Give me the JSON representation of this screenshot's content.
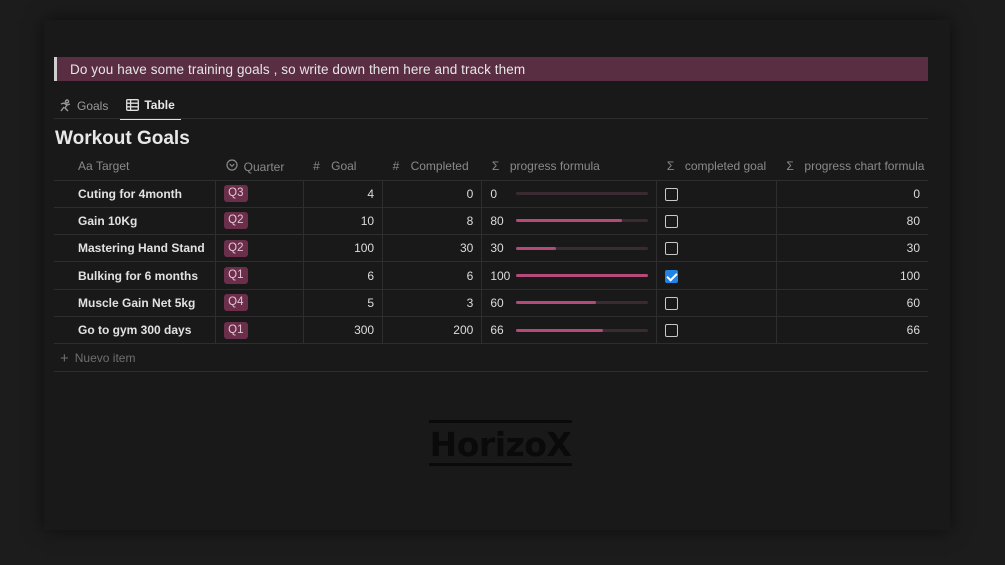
{
  "callout": {
    "text": "Do  you have some training goals , so write down them here and track them"
  },
  "tabs": [
    {
      "label": "Goals",
      "icon": "running-icon",
      "active": false
    },
    {
      "label": "Table",
      "icon": "table-icon",
      "active": true
    }
  ],
  "title": "Workout Goals",
  "columns": {
    "target": {
      "label": "Target",
      "icon": "Aa"
    },
    "quarter": {
      "label": "Quarter",
      "icon": "select-icon"
    },
    "goal": {
      "label": "Goal",
      "icon": "#"
    },
    "completed": {
      "label": "Completed",
      "icon": "#"
    },
    "progress": {
      "label": "progress formula",
      "icon": "Σ"
    },
    "completed_goal": {
      "label": "completed goal",
      "icon": "Σ"
    },
    "chart": {
      "label": "progress chart formula",
      "icon": "Σ"
    }
  },
  "rows": [
    {
      "target": "Cuting for 4month",
      "quarter": "Q3",
      "goal": "4",
      "completed": "0",
      "progress": "0",
      "progress_pct": 0,
      "done": false,
      "chart": "0"
    },
    {
      "target": "Gain 10Kg",
      "quarter": "Q2",
      "goal": "10",
      "completed": "8",
      "progress": "80",
      "progress_pct": 80,
      "done": false,
      "chart": "80"
    },
    {
      "target": "Mastering Hand Stand",
      "quarter": "Q2",
      "goal": "100",
      "completed": "30",
      "progress": "30",
      "progress_pct": 30,
      "done": false,
      "chart": "30"
    },
    {
      "target": "Bulking for 6 months",
      "quarter": "Q1",
      "goal": "6",
      "completed": "6",
      "progress": "100",
      "progress_pct": 100,
      "done": true,
      "chart": "100"
    },
    {
      "target": "Muscle Gain Net 5kg",
      "quarter": "Q4",
      "goal": "5",
      "completed": "3",
      "progress": "60",
      "progress_pct": 60,
      "done": false,
      "chart": "60"
    },
    {
      "target": "Go to gym 300 days",
      "quarter": "Q1",
      "goal": "300",
      "completed": "200",
      "progress": "66",
      "progress_pct": 66,
      "done": false,
      "chart": "66"
    }
  ],
  "new_item": "Nuevo item",
  "logo": "HorizoX",
  "colors": {
    "callout_bg": "#5a2e42",
    "badge_bg": "#6b2f4c",
    "progress_fill": "#b5497a",
    "checkbox_checked": "#2383e2"
  }
}
